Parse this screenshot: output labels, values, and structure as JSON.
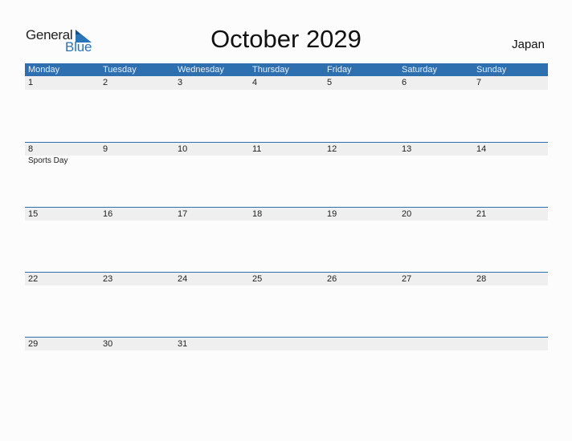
{
  "logo": {
    "general": "General",
    "blue": "Blue"
  },
  "title": "October 2029",
  "country": "Japan",
  "colors": {
    "accent": "#2e6fb0",
    "strip": "#efefef",
    "logo_blue": "#2a74b8"
  },
  "weekdays": [
    "Monday",
    "Tuesday",
    "Wednesday",
    "Thursday",
    "Friday",
    "Saturday",
    "Sunday"
  ],
  "weeks": [
    {
      "days": [
        "1",
        "2",
        "3",
        "4",
        "5",
        "6",
        "7"
      ],
      "events": [
        "",
        "",
        "",
        "",
        "",
        "",
        ""
      ]
    },
    {
      "days": [
        "8",
        "9",
        "10",
        "11",
        "12",
        "13",
        "14"
      ],
      "events": [
        "Sports Day",
        "",
        "",
        "",
        "",
        "",
        ""
      ]
    },
    {
      "days": [
        "15",
        "16",
        "17",
        "18",
        "19",
        "20",
        "21"
      ],
      "events": [
        "",
        "",
        "",
        "",
        "",
        "",
        ""
      ]
    },
    {
      "days": [
        "22",
        "23",
        "24",
        "25",
        "26",
        "27",
        "28"
      ],
      "events": [
        "",
        "",
        "",
        "",
        "",
        "",
        ""
      ]
    },
    {
      "days": [
        "29",
        "30",
        "31",
        "",
        "",
        "",
        ""
      ],
      "events": [
        "",
        "",
        "",
        "",
        "",
        "",
        ""
      ]
    }
  ]
}
